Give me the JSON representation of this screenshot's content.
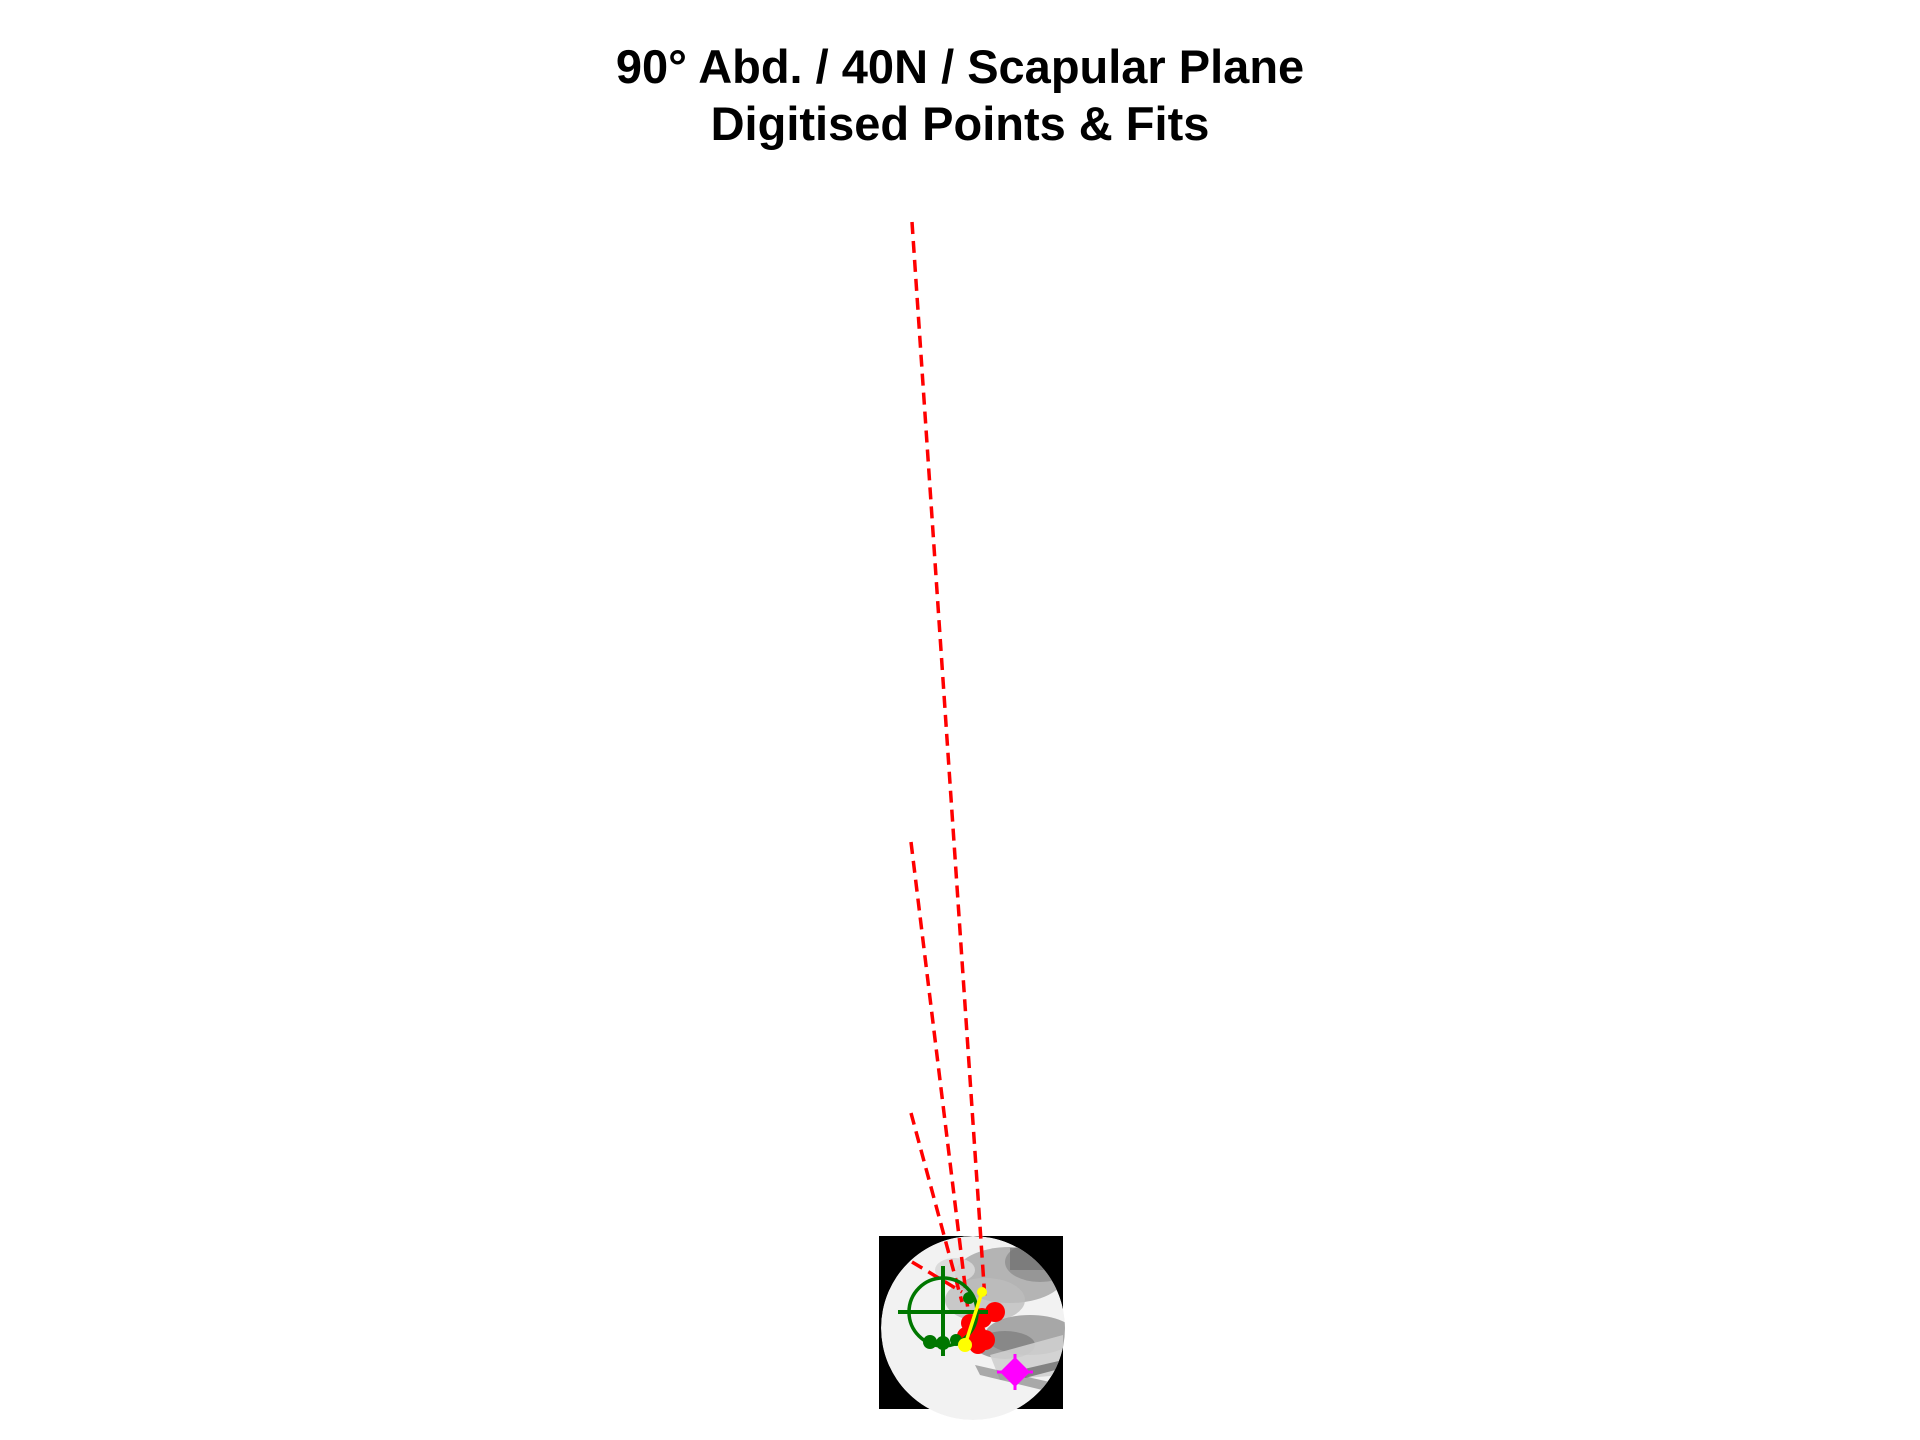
{
  "figure": {
    "title_line_1": "90° Abd. / 40N / Scapular Plane",
    "title_line_2": "Digitised Points & Fits"
  },
  "colors": {
    "background": "#ffffff",
    "fit_lines": "#ff0000",
    "humeral_head_points": "#ff0000",
    "glenoid_fit": "#007700",
    "glenoid_points": "#007700",
    "yellow_axis": "#ffff00",
    "magenta_marker": "#ff00ff",
    "xray_frame": "#000000",
    "xray_field": "#f2f2f2"
  },
  "icons": {
    "green_marker": "crosshair-circle-icon",
    "magenta_marker": "diamond-marker-icon"
  }
}
